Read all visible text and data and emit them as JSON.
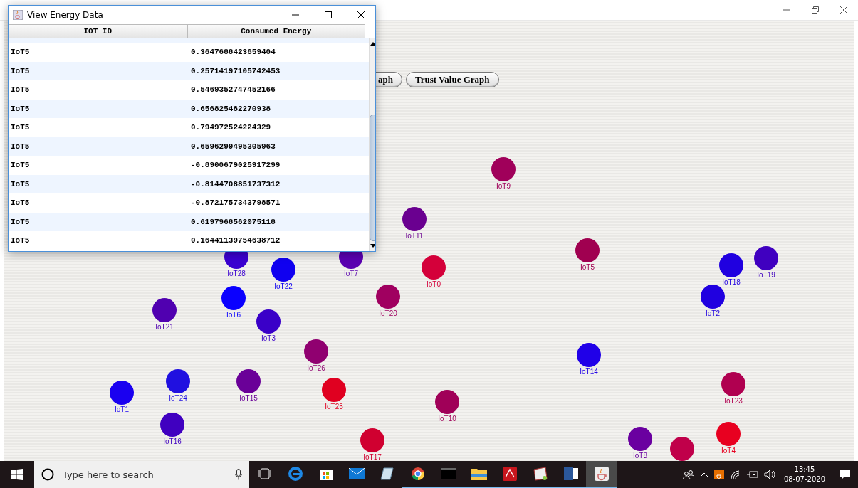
{
  "toolbar": {
    "buttons": [
      {
        "label": "aph"
      },
      {
        "label": "Trust Value Graph"
      }
    ]
  },
  "nodes": [
    {
      "label": "IoT9",
      "color": "#a0005a"
    },
    {
      "label": "IoT11",
      "color": "#6a0090"
    },
    {
      "label": "IoT28",
      "color": "#3a00d0"
    },
    {
      "label": "IoT22",
      "color": "#1000f0"
    },
    {
      "label": "IoT7",
      "color": "#5a00b0"
    },
    {
      "label": "IoT0",
      "color": "#d4003a"
    },
    {
      "label": "IoT5",
      "color": "#a00050"
    },
    {
      "label": "IoT18",
      "color": "#2000e0"
    },
    {
      "label": "IoT19",
      "color": "#4000c0"
    },
    {
      "label": "IoT21",
      "color": "#5000b0"
    },
    {
      "label": "IoT6",
      "color": "#0a00ff"
    },
    {
      "label": "IoT3",
      "color": "#3a00c8"
    },
    {
      "label": "IoT20",
      "color": "#a00060"
    },
    {
      "label": "IoT2",
      "color": "#2000e0"
    },
    {
      "label": "IoT26",
      "color": "#900070"
    },
    {
      "label": "IoT14",
      "color": "#2000e8"
    },
    {
      "label": "IoT1",
      "color": "#1a00f0"
    },
    {
      "label": "IoT24",
      "color": "#2010e0"
    },
    {
      "label": "IoT15",
      "color": "#6a0098"
    },
    {
      "label": "IoT25",
      "color": "#e00020"
    },
    {
      "label": "IoT10",
      "color": "#a00058"
    },
    {
      "label": "IoT23",
      "color": "#b00050"
    },
    {
      "label": "IoT16",
      "color": "#4000c0"
    },
    {
      "label": "IoT17",
      "color": "#d00030"
    },
    {
      "label": "IoT8",
      "color": "#6a00a0"
    },
    {
      "color": "#c0004a"
    },
    {
      "label": "IoT4",
      "color": "#e80020"
    }
  ],
  "dialog": {
    "title": "View Energy Data",
    "columns": [
      "IOT ID",
      "Consumed Energy"
    ],
    "rows": [
      [
        "IoT5",
        "0.3647688423659404"
      ],
      [
        "IoT5",
        "0.25714197105742453"
      ],
      [
        "IoT5",
        "0.5469352747452166"
      ],
      [
        "IoT5",
        "0.656825482270938"
      ],
      [
        "IoT5",
        "0.794972524224329"
      ],
      [
        "IoT5",
        "0.6596299495305963"
      ],
      [
        "IoT5",
        "-0.8900679025917299"
      ],
      [
        "IoT5",
        "-0.8144708851737312"
      ],
      [
        "IoT5",
        "-0.8721757343798571"
      ],
      [
        "IoT5",
        "0.6197968562075118"
      ],
      [
        "IoT5",
        "0.16441139754638712"
      ]
    ]
  },
  "taskbar": {
    "search": {
      "placeholder": "Type here to search"
    },
    "apps": [
      {
        "kind": "taskview",
        "running": false,
        "selected": false
      },
      {
        "kind": "browser-e",
        "running": false,
        "selected": false
      },
      {
        "kind": "store",
        "running": false,
        "selected": false
      },
      {
        "kind": "mail",
        "running": false,
        "selected": false
      },
      {
        "kind": "notes",
        "running": false,
        "selected": false
      },
      {
        "kind": "chrome",
        "running": true,
        "selected": false
      },
      {
        "kind": "terminal",
        "running": true,
        "selected": false
      },
      {
        "kind": "folder",
        "running": true,
        "selected": false
      },
      {
        "kind": "pdf",
        "running": true,
        "selected": false
      },
      {
        "kind": "drawing",
        "running": true,
        "selected": false
      },
      {
        "kind": "word",
        "running": true,
        "selected": false
      },
      {
        "kind": "java",
        "running": true,
        "selected": true
      }
    ],
    "clock": {
      "time": "13:45",
      "date": "08-07-2020"
    }
  }
}
